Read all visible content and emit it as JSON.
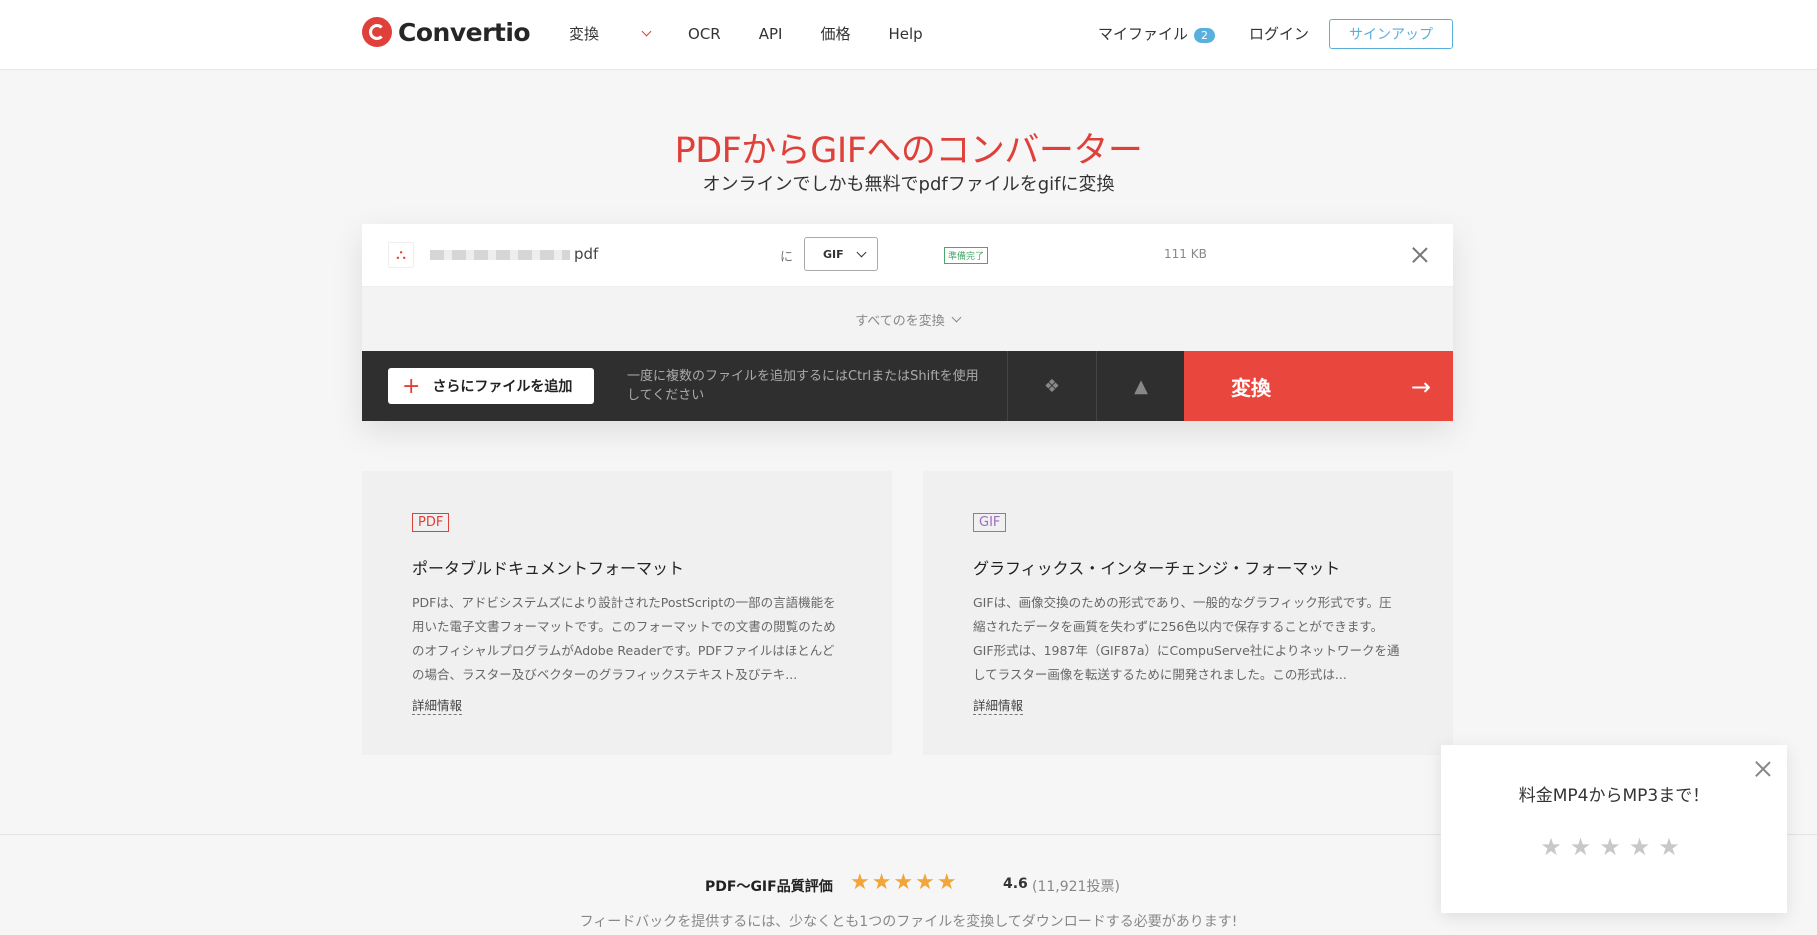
{
  "header": {
    "logo": "Convertio",
    "nav": [
      "変換",
      "OCR",
      "API",
      "価格",
      "Help"
    ],
    "my_files": "マイファイル",
    "my_files_count": "2",
    "login": "ログイン",
    "signup": "サインアップ"
  },
  "hero": {
    "title": "PDFからGIFへのコンバーター",
    "subtitle": "オンラインでしかも無料でpdfファイルをgifに変換"
  },
  "file": {
    "name_suffix": "pdf",
    "to": "に",
    "format": "GIF",
    "status": "準備完了",
    "size": "111 KB"
  },
  "convert_all": "すべてのを変換",
  "toolbar": {
    "add_files": "さらにファイルを追加",
    "hint": "一度に複数のファイルを追加するにはCtrlまたはShiftを使用してください",
    "convert": "変換"
  },
  "cards": [
    {
      "tag": "PDF",
      "title": "ポータブルドキュメントフォーマット",
      "body": "PDFは、アドビシステムズにより設計されたPostScriptの一部の言語機能を用いた電子文書フォーマットです。このフォーマットでの文書の閲覧のためのオフィシャルプログラムがAdobe Readerです。PDFファイルはほとんどの場合、ラスター及びベクターのグラフィックステキスト及びテキ...",
      "link": "詳細情報"
    },
    {
      "tag": "GIF",
      "title": "グラフィックス・インターチェンジ・フォーマット",
      "body": "GIFは、画像交換のための形式であり、一般的なグラフィック形式です。圧縮されたデータを画質を失わずに256色以内で保存することができます。GIF形式は、1987年（GIF87a）にCompuServe社によりネットワークを通してラスター画像を転送するために開発されました。この形式は...",
      "link": "詳細情報"
    }
  ],
  "rating": {
    "label": "PDF〜GIF品質評価",
    "stars": "★★★★★",
    "score": "4.6",
    "votes": "(11,921投票)",
    "note": "フィードバックを提供するには、少なくとも1つのファイルを変換してダウンロードする必要があります!"
  },
  "popup": {
    "title": "料金MP4からMP3まで！",
    "stars": "★★★★★"
  }
}
